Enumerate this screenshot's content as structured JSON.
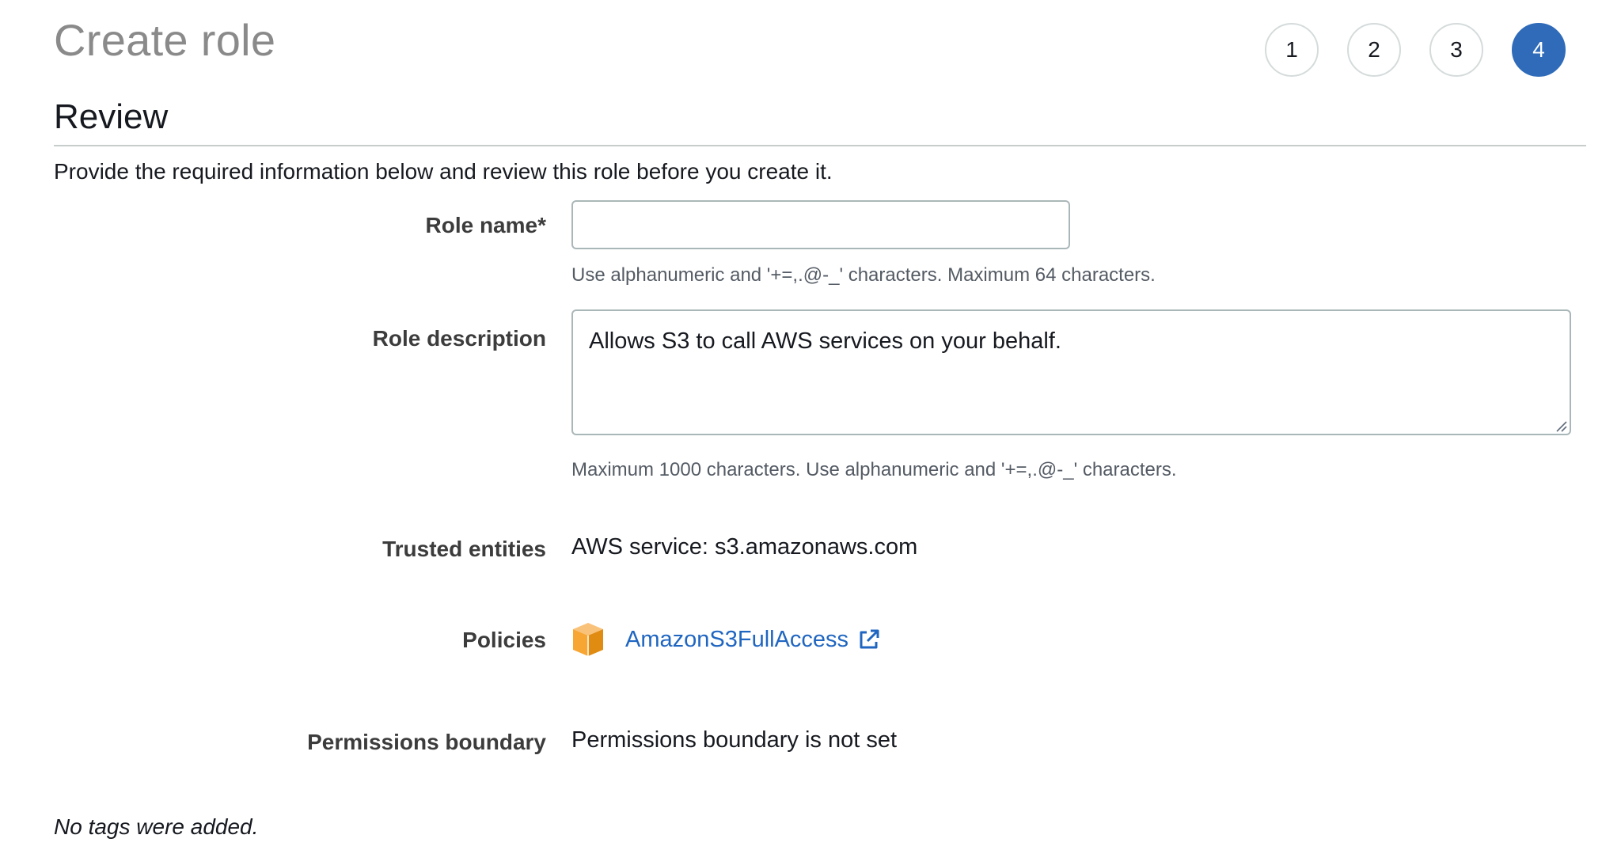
{
  "header": {
    "title": "Create role",
    "steps": [
      "1",
      "2",
      "3",
      "4"
    ],
    "active_step": "4"
  },
  "section": {
    "title": "Review",
    "intro": "Provide the required information below and review this role before you create it."
  },
  "form": {
    "role_name": {
      "label": "Role name*",
      "value": "",
      "hint": "Use alphanumeric and '+=,.@-_' characters. Maximum 64 characters."
    },
    "role_description": {
      "label": "Role description",
      "value": "Allows S3 to call AWS services on your behalf.",
      "hint": "Maximum 1000 characters. Use alphanumeric and '+=,.@-_' characters."
    },
    "trusted_entities": {
      "label": "Trusted entities",
      "value": "AWS service: s3.amazonaws.com"
    },
    "policies": {
      "label": "Policies",
      "items": [
        {
          "name": "AmazonS3FullAccess",
          "icon": "policy-box-icon"
        }
      ]
    },
    "permissions_boundary": {
      "label": "Permissions boundary",
      "value": "Permissions boundary is not set"
    }
  },
  "tags": {
    "message": "No tags were added."
  },
  "colors": {
    "active_step": "#2f6bb9",
    "link": "#2066c1",
    "policy_icon": "#f7a634"
  }
}
